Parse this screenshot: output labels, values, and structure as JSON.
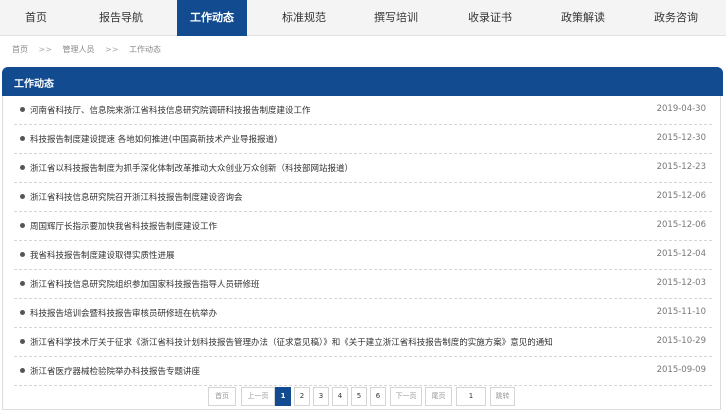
{
  "nav": {
    "items": [
      {
        "label": "首页"
      },
      {
        "label": "报告导航"
      },
      {
        "label": "工作动态"
      },
      {
        "label": "标准规范"
      },
      {
        "label": "撰写培训"
      },
      {
        "label": "收录证书"
      },
      {
        "label": "政策解读"
      },
      {
        "label": "政务咨询"
      }
    ],
    "active_index": 2
  },
  "breadcrumb": {
    "items": [
      "首页",
      "管理人员",
      "工作动态"
    ],
    "separator": ">>"
  },
  "panel": {
    "title": "工作动态"
  },
  "articles": [
    {
      "title": "河南省科技厅、信息院来浙江省科技信息研究院调研科技报告制度建设工作",
      "date": "2019-04-30"
    },
    {
      "title": "科技报告制度建设提速 各地如何推进(中国高新技术产业导报报道)",
      "date": "2015-12-30"
    },
    {
      "title": "浙江省以科技报告制度为抓手深化体制改革推动大众创业万众创新（科技部网站报道）",
      "date": "2015-12-23"
    },
    {
      "title": "浙江省科技信息研究院召开浙江科技报告制度建设咨询会",
      "date": "2015-12-06"
    },
    {
      "title": "周国辉厅长指示要加快我省科技报告制度建设工作",
      "date": "2015-12-06"
    },
    {
      "title": "我省科技报告制度建设取得实质性进展",
      "date": "2015-12-04"
    },
    {
      "title": "浙江省科技信息研究院组织参加国家科技报告指导人员研修班",
      "date": "2015-12-03"
    },
    {
      "title": "科技报告培训会暨科技报告审核员研修班在杭举办",
      "date": "2015-11-10"
    },
    {
      "title": "浙江省科学技术厅关于征求《浙江省科技计划科技报告管理办法（征求意见稿）》和《关于建立浙江省科技报告制度的实施方案》意见的通知",
      "date": "2015-10-29"
    },
    {
      "title": "浙江省医疗器械检验院举办科技报告专题讲座",
      "date": "2015-09-09"
    }
  ],
  "pagination": {
    "first": "首页",
    "prev": "上一页",
    "pages": [
      "1",
      "2",
      "3",
      "4",
      "5",
      "6"
    ],
    "current": "1",
    "next": "下一页",
    "last": "尾页",
    "jump_value": "1",
    "jump_label": "跳转"
  },
  "colors": {
    "accent": "#124b8f"
  }
}
